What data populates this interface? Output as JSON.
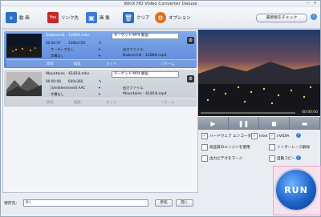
{
  "window": {
    "title": "WinX HD Video Converter Deluxe",
    "controls": [
      "—",
      "✕"
    ]
  },
  "toolbar": {
    "video_label": "動 画",
    "youtube_label": "リンク先",
    "image_label": "画 像",
    "clear_label": "クリア",
    "options_label": "オプション",
    "check_update_label": "最新版をチェック",
    "help_icon": "i",
    "colors": {
      "video": "#2d6fc4",
      "youtube": "#c62828",
      "image": "#3a7bd5",
      "clear": "#2d6fc4",
      "options": "#e0701f"
    }
  },
  "files": [
    {
      "source_name": "Dubrovnik - 12866.mkv",
      "duration": "00:00:07",
      "resolution": "1280x720",
      "audio": "オーディオなし",
      "subtitle": "字幕なし",
      "target": "ターゲット:MP4 動画",
      "output_label": "出力ファイル:",
      "output_name": "Dubrovnik - 12866.mp4",
      "info_label": "情報",
      "edit_label": "編集",
      "cut_label": "カット",
      "trim_label": "リネーム",
      "selected": true
    },
    {
      "source_name": "Mountains - 61818.mkv",
      "duration": "00:00:08",
      "resolution": "640x360",
      "audio": "[Undetermined] AAC",
      "subtitle": "字幕なし",
      "target": "ターゲット:MP4 動画",
      "output_label": "出力ファイル:",
      "output_name": "Mountains - 61818.mp4",
      "info_label": "情報",
      "edit_label": "編集",
      "cut_label": "カット",
      "trim_label": "リネーム",
      "selected": false
    }
  ],
  "player": {
    "time": "00:00:00",
    "buttons": [
      "▶",
      "❚❚",
      "◼",
      "▬"
    ]
  },
  "options": {
    "hw_encoder": "ハードウェア エンコーダー:",
    "intel": "Intel",
    "nvidia": "nVIDIA",
    "hq_engine": "高品質のエンジンを使用",
    "deinterlace": "インターレース解除",
    "merge": "出力ビデオをマージ",
    "autocopy": "自動コピー"
  },
  "bottom": {
    "dest_label": "保存先:",
    "dest_path": "D:\\",
    "browse_label": "参照",
    "open_label": "開く"
  },
  "run_label": "RUN"
}
